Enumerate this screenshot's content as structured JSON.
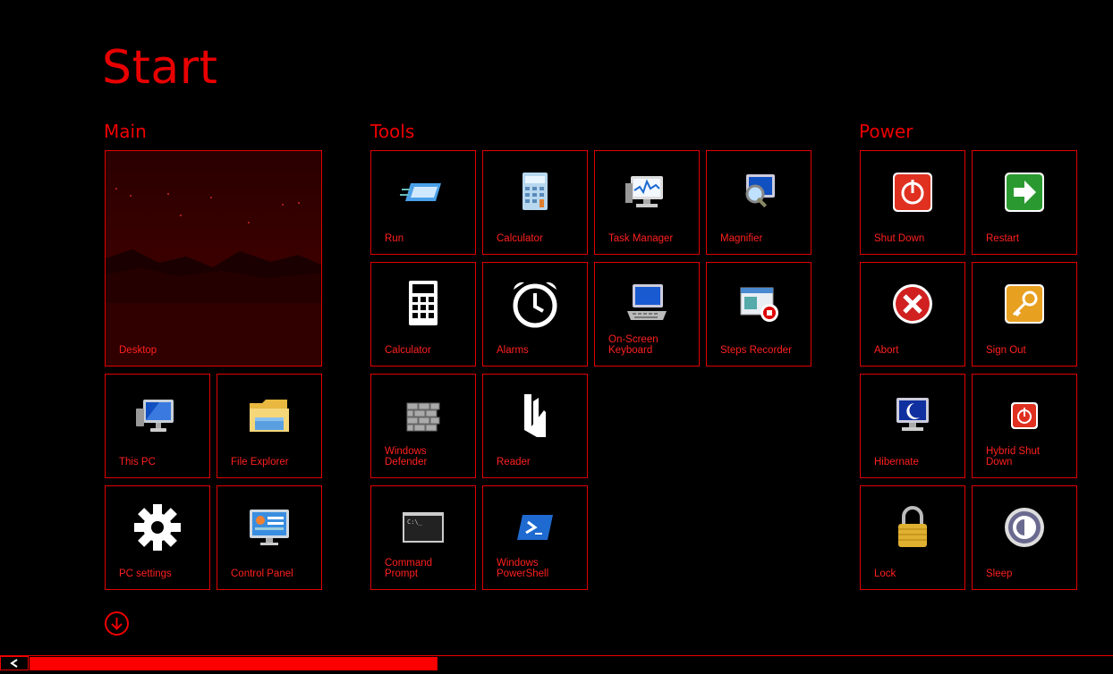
{
  "header": {
    "title": "Start"
  },
  "groups": {
    "main": "Main",
    "tools": "Tools",
    "power": "Power"
  },
  "tiles": {
    "desktop": "Desktop",
    "this_pc": "This PC",
    "file_explorer": "File Explorer",
    "pc_settings": "PC settings",
    "control_panel": "Control Panel",
    "run": "Run",
    "calculator_1": "Calculator",
    "task_manager": "Task Manager",
    "magnifier": "Magnifier",
    "calculator_2": "Calculator",
    "alarms": "Alarms",
    "on_screen_keyboard": "On-Screen\nKeyboard",
    "steps_recorder": "Steps Recorder",
    "windows_defender": "Windows\nDefender",
    "reader": "Reader",
    "command_prompt": "Command\nPrompt",
    "windows_powershell": "Windows\nPowerShell",
    "shut_down": "Shut Down",
    "restart": "Restart",
    "abort": "Abort",
    "sign_out": "Sign Out",
    "hibernate": "Hibernate",
    "hybrid_shut_down": "Hybrid Shut\nDown",
    "lock": "Lock",
    "sleep": "Sleep"
  },
  "colors": {
    "accent": "#e00000",
    "background": "#000000"
  },
  "scrollbar": {
    "position": 0.37
  }
}
